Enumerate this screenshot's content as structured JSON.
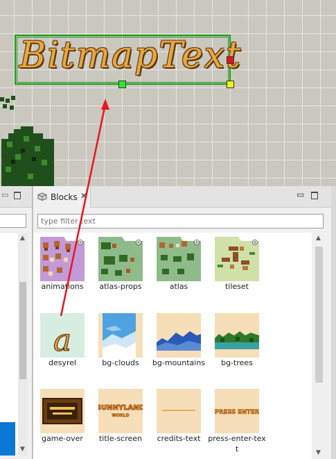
{
  "scene": {
    "bitmap_text": "BitmapText"
  },
  "left_panel": {},
  "blocks_panel": {
    "tab_label": "Blocks",
    "close_glyph": "✕",
    "filter_placeholder": "type filter text",
    "items": [
      {
        "label": "animations"
      },
      {
        "label": "atlas-props"
      },
      {
        "label": "atlas"
      },
      {
        "label": "tileset"
      },
      {
        "label": "desyrel"
      },
      {
        "label": "bg-clouds"
      },
      {
        "label": "bg-mountains"
      },
      {
        "label": "bg-trees"
      },
      {
        "label": "game-over"
      },
      {
        "label": "title-screen"
      },
      {
        "label": "credits-text"
      },
      {
        "label": "press-enter-text"
      }
    ],
    "thumb_text": {
      "desyrel": "a",
      "title_line1": "SUNNYLAND",
      "title_line2": "WORLD",
      "press": "PRESS ENTER"
    }
  },
  "colors": {
    "selection": "#1a9a1a",
    "accent_blue": "#0a78d7",
    "annotation_arrow": "#e8141e"
  }
}
